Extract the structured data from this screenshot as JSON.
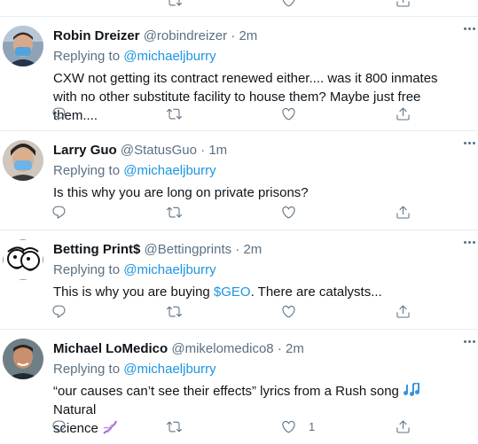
{
  "tweets": [
    {
      "name": "Robin Dreizer",
      "handle": "@robindreizer",
      "sep": "·",
      "time": "2m",
      "replying": "Replying to",
      "reply_to": "@michaeljburry",
      "text": "CXW not getting its contract renewed either.... was it 800 inmates with no other substitute facility to house them? Maybe just free them....",
      "likes": ""
    },
    {
      "name": "Larry Guo",
      "handle": "@StatusGuo",
      "sep": "·",
      "time": "1m",
      "replying": "Replying to",
      "reply_to": "@michaeljburry",
      "text": "Is this why you are long on private prisons?",
      "likes": ""
    },
    {
      "name": "Betting Print$",
      "handle": "@Bettingprints",
      "sep": "·",
      "time": "2m",
      "replying": "Replying to",
      "reply_to": "@michaeljburry",
      "text_before": "This is why you are buying ",
      "cashtag": "$GEO",
      "text_after": ". There are catalysts...",
      "likes": ""
    },
    {
      "name": "Michael LoMedico",
      "handle": "@mikelomedico8",
      "sep": "·",
      "time": "2m",
      "replying": "Replying to",
      "reply_to": "@michaeljburry",
      "text_line1": "“our causes can’t see their effects” lyrics from a Rush song",
      "text_line1b": "Natural",
      "text_line2": "science",
      "likes": "1"
    }
  ],
  "colors": {
    "link": "#1b95e0",
    "secondary": "#5b7083",
    "text": "#0f1419",
    "divider": "#e6ecf0"
  },
  "icons": [
    "reply-icon",
    "retweet-icon",
    "like-icon",
    "share-icon",
    "more-icon",
    "music-notes-emoji",
    "dna-emoji"
  ]
}
